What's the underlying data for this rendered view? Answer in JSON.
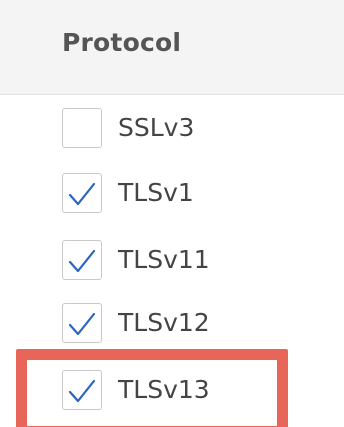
{
  "table": {
    "column_header": "Protocol",
    "options": [
      {
        "label": "SSLv3",
        "checked": false
      },
      {
        "label": "TLSv1",
        "checked": true
      },
      {
        "label": "TLSv11",
        "checked": true
      },
      {
        "label": "TLSv12",
        "checked": true
      },
      {
        "label": "TLSv13",
        "checked": true
      }
    ]
  },
  "colors": {
    "checkmark": "#2a65c1",
    "highlight": "#e8655a",
    "header_bg": "#f4f4f4"
  }
}
